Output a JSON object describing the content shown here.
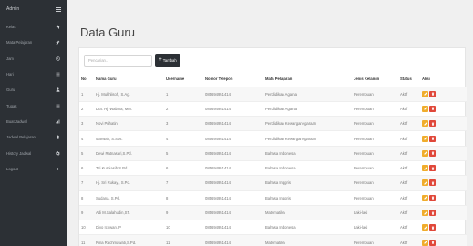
{
  "sidebar": {
    "title": "Admin",
    "items": [
      {
        "label": "Kelas",
        "icon": "home-icon"
      },
      {
        "label": "Mata Pelajaran",
        "icon": "pin-icon"
      },
      {
        "label": "Jam",
        "icon": "clock-icon"
      },
      {
        "label": "Hari",
        "icon": "list-icon"
      },
      {
        "label": "Guru",
        "icon": "user-icon"
      },
      {
        "label": "Tugas",
        "icon": "list-icon"
      },
      {
        "label": "Buat Jadwal",
        "icon": "chart-icon"
      },
      {
        "label": "Jadwal Pelajaran",
        "icon": "trash-icon"
      },
      {
        "label": "History Jadwal",
        "icon": "gear-icon"
      },
      {
        "label": "Logout",
        "icon": "chevron-right-icon"
      }
    ]
  },
  "page": {
    "title": "Data Guru"
  },
  "toolbar": {
    "search_placeholder": "Pencarian...",
    "add_label": "Tambah"
  },
  "table": {
    "headers": [
      "No",
      "Nama Guru",
      "Username",
      "Nomor Telepon",
      "Mata Pelajaran",
      "Jenis Kelamin",
      "Status",
      "Aksi"
    ],
    "rows": [
      {
        "no": "1",
        "nama": "Hj. Mukhlisoh, S.Ag.",
        "username": "1",
        "telepon": "085694951414",
        "mapel": "Pendidikan Agama",
        "jk": "Perempuan",
        "status": "Aktif"
      },
      {
        "no": "2",
        "nama": "Dra. Hj. Walana, MM.",
        "username": "2",
        "telepon": "085694951414",
        "mapel": "Pendidikan Agama",
        "jk": "Perempuan",
        "status": "Aktif"
      },
      {
        "no": "3",
        "nama": "Novi Prihatini",
        "username": "3",
        "telepon": "085694951414",
        "mapel": "Pendidikan Kewarganegaraan",
        "jk": "Perempuan",
        "status": "Aktif"
      },
      {
        "no": "4",
        "nama": "Marwah, S.Sos.",
        "username": "4",
        "telepon": "085694951414",
        "mapel": "Pendidikan Kewarganegaraan",
        "jk": "Perempuan",
        "status": "Aktif"
      },
      {
        "no": "5",
        "nama": "Dewi Ratnasari,S.Pd.",
        "username": "5",
        "telepon": "085694951414",
        "mapel": "Bahasa Indonesia",
        "jk": "Perempuan",
        "status": "Aktif"
      },
      {
        "no": "6",
        "nama": "Titi Kurniasih,S.Pd.",
        "username": "6",
        "telepon": "085694951414",
        "mapel": "Bahasa Indonesia",
        "jk": "Perempuan",
        "status": "Aktif"
      },
      {
        "no": "7",
        "nama": "Hj. Sri Rukayi, S.Pd.",
        "username": "7",
        "telepon": "085694951414",
        "mapel": "Bahasa Inggris",
        "jk": "Perempuan",
        "status": "Aktif"
      },
      {
        "no": "8",
        "nama": "Sudana, S.Pd.",
        "username": "8",
        "telepon": "085694951414",
        "mapel": "Bahasa Inggris",
        "jk": "Perempuan",
        "status": "Aktif"
      },
      {
        "no": "9",
        "nama": "Adi M.Salahudin,ST.",
        "username": "9",
        "telepon": "085694951414",
        "mapel": "Matematika",
        "jk": "Laki-laki",
        "status": "Aktif"
      },
      {
        "no": "10",
        "nama": "Divo Ichwan. P",
        "username": "10",
        "telepon": "085694951414",
        "mapel": "Bahasa Indonesia",
        "jk": "Laki-laki",
        "status": "Aktif"
      },
      {
        "no": "11",
        "nama": "Rina Rachmawati,S.Pd.",
        "username": "11",
        "telepon": "085694951414",
        "mapel": "Matematika",
        "jk": "Perempuan",
        "status": "Aktif"
      }
    ]
  },
  "colors": {
    "sidebar": "#2c3035",
    "edit": "#f0ad2c",
    "delete": "#e0483a"
  }
}
